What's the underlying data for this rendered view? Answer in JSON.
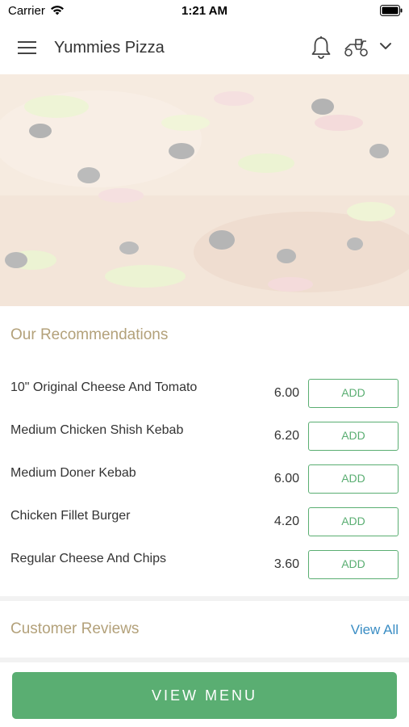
{
  "status_bar": {
    "carrier": "Carrier",
    "time": "1:21 AM"
  },
  "header": {
    "title": "Yummies Pizza"
  },
  "recommendations": {
    "title": "Our Recommendations",
    "items": [
      {
        "name": "10\" Original Cheese And Tomato",
        "price": "6.00",
        "button": "ADD"
      },
      {
        "name": "Medium Chicken Shish Kebab",
        "price": "6.20",
        "button": "ADD"
      },
      {
        "name": "Medium Doner Kebab",
        "price": "6.00",
        "button": "ADD"
      },
      {
        "name": "Chicken Fillet Burger",
        "price": "4.20",
        "button": "ADD"
      },
      {
        "name": "Regular Cheese And Chips",
        "price": "3.60",
        "button": "ADD"
      }
    ]
  },
  "reviews": {
    "title": "Customer Reviews",
    "view_all": "View All"
  },
  "footer": {
    "view_menu": "VIEW MENU"
  },
  "colors": {
    "accent_green": "#5aae72",
    "section_title": "#b3a17a",
    "link_blue": "#3a8dc4"
  }
}
